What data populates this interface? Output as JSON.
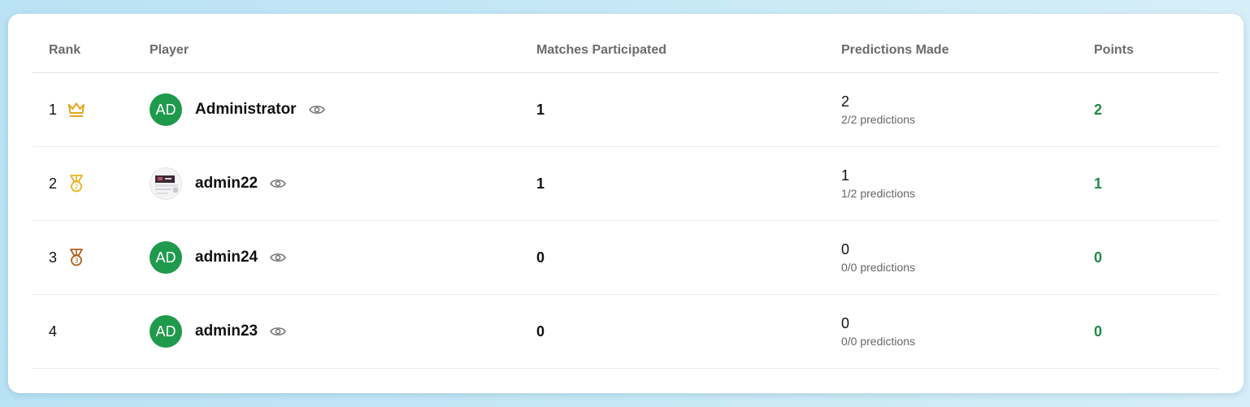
{
  "columns": {
    "rank": "Rank",
    "player": "Player",
    "matches": "Matches Participated",
    "predictions": "Predictions Made",
    "points": "Points"
  },
  "rows": [
    {
      "rank": "1",
      "rank_icon": "crown-icon",
      "avatar_initials": "AD",
      "name": "Administrator",
      "matches": "1",
      "predictions": "2",
      "predictions_detail": "2/2 predictions",
      "points": "2"
    },
    {
      "rank": "2",
      "rank_icon": "silver-medal-icon",
      "avatar_initials": "",
      "name": "admin22",
      "matches": "1",
      "predictions": "1",
      "predictions_detail": "1/2 predictions",
      "points": "1"
    },
    {
      "rank": "3",
      "rank_icon": "bronze-medal-icon",
      "avatar_initials": "AD",
      "name": "admin24",
      "matches": "0",
      "predictions": "0",
      "predictions_detail": "0/0 predictions",
      "points": "0"
    },
    {
      "rank": "4",
      "rank_icon": "",
      "avatar_initials": "AD",
      "name": "admin23",
      "matches": "0",
      "predictions": "0",
      "predictions_detail": "0/0 predictions",
      "points": "0"
    }
  ],
  "colors": {
    "avatar_bg": "#1f9a4c",
    "points": "#1f8a45",
    "crown": "#e3a51c",
    "silver_medal": "#e6b422",
    "bronze_medal": "#b0641e"
  }
}
